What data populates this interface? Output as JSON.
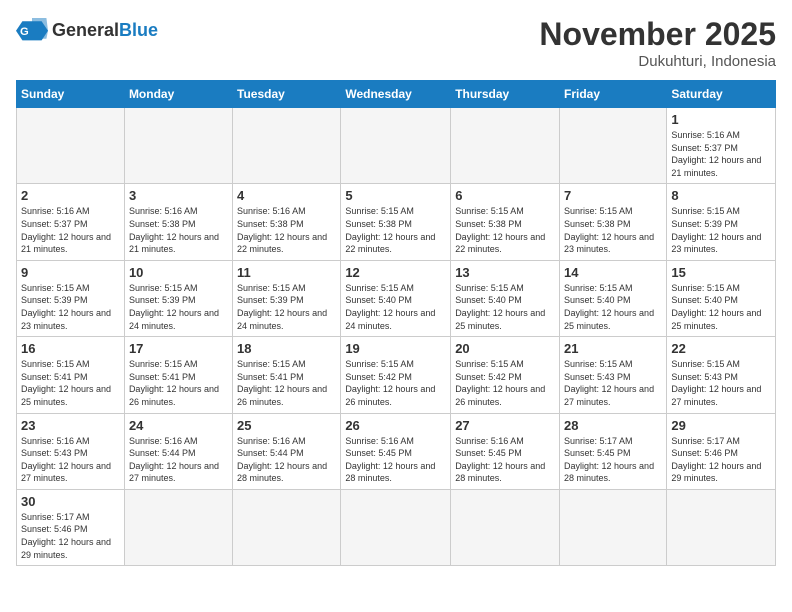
{
  "header": {
    "logo_general": "General",
    "logo_blue": "Blue",
    "month_title": "November 2025",
    "location": "Dukuhturi, Indonesia"
  },
  "days_of_week": [
    "Sunday",
    "Monday",
    "Tuesday",
    "Wednesday",
    "Thursday",
    "Friday",
    "Saturday"
  ],
  "weeks": [
    [
      {
        "day": "",
        "info": ""
      },
      {
        "day": "",
        "info": ""
      },
      {
        "day": "",
        "info": ""
      },
      {
        "day": "",
        "info": ""
      },
      {
        "day": "",
        "info": ""
      },
      {
        "day": "",
        "info": ""
      },
      {
        "day": "1",
        "info": "Sunrise: 5:16 AM\nSunset: 5:37 PM\nDaylight: 12 hours\nand 21 minutes."
      }
    ],
    [
      {
        "day": "2",
        "info": "Sunrise: 5:16 AM\nSunset: 5:37 PM\nDaylight: 12 hours\nand 21 minutes."
      },
      {
        "day": "3",
        "info": "Sunrise: 5:16 AM\nSunset: 5:38 PM\nDaylight: 12 hours\nand 21 minutes."
      },
      {
        "day": "4",
        "info": "Sunrise: 5:16 AM\nSunset: 5:38 PM\nDaylight: 12 hours\nand 22 minutes."
      },
      {
        "day": "5",
        "info": "Sunrise: 5:15 AM\nSunset: 5:38 PM\nDaylight: 12 hours\nand 22 minutes."
      },
      {
        "day": "6",
        "info": "Sunrise: 5:15 AM\nSunset: 5:38 PM\nDaylight: 12 hours\nand 22 minutes."
      },
      {
        "day": "7",
        "info": "Sunrise: 5:15 AM\nSunset: 5:38 PM\nDaylight: 12 hours\nand 23 minutes."
      },
      {
        "day": "8",
        "info": "Sunrise: 5:15 AM\nSunset: 5:39 PM\nDaylight: 12 hours\nand 23 minutes."
      }
    ],
    [
      {
        "day": "9",
        "info": "Sunrise: 5:15 AM\nSunset: 5:39 PM\nDaylight: 12 hours\nand 23 minutes."
      },
      {
        "day": "10",
        "info": "Sunrise: 5:15 AM\nSunset: 5:39 PM\nDaylight: 12 hours\nand 24 minutes."
      },
      {
        "day": "11",
        "info": "Sunrise: 5:15 AM\nSunset: 5:39 PM\nDaylight: 12 hours\nand 24 minutes."
      },
      {
        "day": "12",
        "info": "Sunrise: 5:15 AM\nSunset: 5:40 PM\nDaylight: 12 hours\nand 24 minutes."
      },
      {
        "day": "13",
        "info": "Sunrise: 5:15 AM\nSunset: 5:40 PM\nDaylight: 12 hours\nand 25 minutes."
      },
      {
        "day": "14",
        "info": "Sunrise: 5:15 AM\nSunset: 5:40 PM\nDaylight: 12 hours\nand 25 minutes."
      },
      {
        "day": "15",
        "info": "Sunrise: 5:15 AM\nSunset: 5:40 PM\nDaylight: 12 hours\nand 25 minutes."
      }
    ],
    [
      {
        "day": "16",
        "info": "Sunrise: 5:15 AM\nSunset: 5:41 PM\nDaylight: 12 hours\nand 25 minutes."
      },
      {
        "day": "17",
        "info": "Sunrise: 5:15 AM\nSunset: 5:41 PM\nDaylight: 12 hours\nand 26 minutes."
      },
      {
        "day": "18",
        "info": "Sunrise: 5:15 AM\nSunset: 5:41 PM\nDaylight: 12 hours\nand 26 minutes."
      },
      {
        "day": "19",
        "info": "Sunrise: 5:15 AM\nSunset: 5:42 PM\nDaylight: 12 hours\nand 26 minutes."
      },
      {
        "day": "20",
        "info": "Sunrise: 5:15 AM\nSunset: 5:42 PM\nDaylight: 12 hours\nand 26 minutes."
      },
      {
        "day": "21",
        "info": "Sunrise: 5:15 AM\nSunset: 5:43 PM\nDaylight: 12 hours\nand 27 minutes."
      },
      {
        "day": "22",
        "info": "Sunrise: 5:15 AM\nSunset: 5:43 PM\nDaylight: 12 hours\nand 27 minutes."
      }
    ],
    [
      {
        "day": "23",
        "info": "Sunrise: 5:16 AM\nSunset: 5:43 PM\nDaylight: 12 hours\nand 27 minutes."
      },
      {
        "day": "24",
        "info": "Sunrise: 5:16 AM\nSunset: 5:44 PM\nDaylight: 12 hours\nand 27 minutes."
      },
      {
        "day": "25",
        "info": "Sunrise: 5:16 AM\nSunset: 5:44 PM\nDaylight: 12 hours\nand 28 minutes."
      },
      {
        "day": "26",
        "info": "Sunrise: 5:16 AM\nSunset: 5:45 PM\nDaylight: 12 hours\nand 28 minutes."
      },
      {
        "day": "27",
        "info": "Sunrise: 5:16 AM\nSunset: 5:45 PM\nDaylight: 12 hours\nand 28 minutes."
      },
      {
        "day": "28",
        "info": "Sunrise: 5:17 AM\nSunset: 5:45 PM\nDaylight: 12 hours\nand 28 minutes."
      },
      {
        "day": "29",
        "info": "Sunrise: 5:17 AM\nSunset: 5:46 PM\nDaylight: 12 hours\nand 29 minutes."
      }
    ],
    [
      {
        "day": "30",
        "info": "Sunrise: 5:17 AM\nSunset: 5:46 PM\nDaylight: 12 hours\nand 29 minutes."
      },
      {
        "day": "",
        "info": ""
      },
      {
        "day": "",
        "info": ""
      },
      {
        "day": "",
        "info": ""
      },
      {
        "day": "",
        "info": ""
      },
      {
        "day": "",
        "info": ""
      },
      {
        "day": "",
        "info": ""
      }
    ]
  ]
}
